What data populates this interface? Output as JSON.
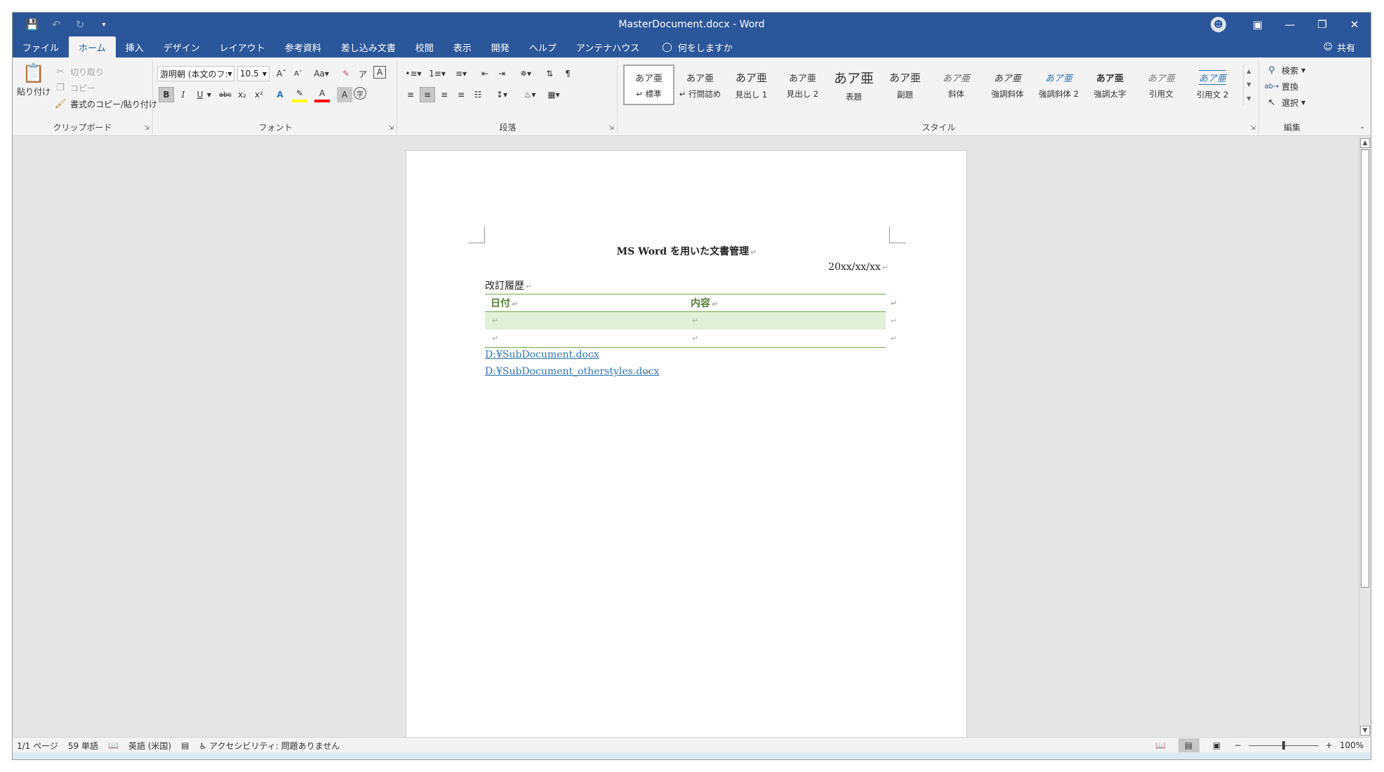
{
  "window": {
    "title": "MasterDocument.docx  -  Word"
  },
  "menu": {
    "tabs": [
      "ファイル",
      "ホーム",
      "挿入",
      "デザイン",
      "レイアウト",
      "参考資料",
      "差し込み文書",
      "校閲",
      "表示",
      "開発",
      "ヘルプ",
      "アンテナハウス"
    ],
    "active_tab": "ホーム",
    "tell_me": "何をしますか",
    "share": "共有"
  },
  "ribbon": {
    "clipboard": {
      "label": "クリップボード",
      "paste": "貼り付け",
      "cut": "切り取り",
      "copy": "コピー",
      "format_painter": "書式のコピー/貼り付け"
    },
    "font": {
      "label": "フォント",
      "font_name": "游明朝 (本文のフ:",
      "font_size": "10.5"
    },
    "paragraph": {
      "label": "段落"
    },
    "styles": {
      "label": "スタイル",
      "items": [
        {
          "sample": "あア亜",
          "name": "↵ 標準"
        },
        {
          "sample": "あア亜",
          "name": "↵ 行間詰め"
        },
        {
          "sample": "あア亜",
          "name": "見出し 1"
        },
        {
          "sample": "あア亜",
          "name": "見出し 2"
        },
        {
          "sample": "あア亜",
          "name": "表題"
        },
        {
          "sample": "あア亜",
          "name": "副題"
        },
        {
          "sample": "あア亜",
          "name": "斜体"
        },
        {
          "sample": "あア亜",
          "name": "強調斜体"
        },
        {
          "sample": "あア亜",
          "name": "強調斜体 2"
        },
        {
          "sample": "あア亜",
          "name": "強調太字"
        },
        {
          "sample": "あア亜",
          "name": "引用文"
        },
        {
          "sample": "あア亜",
          "name": "引用文 2"
        }
      ]
    },
    "editing": {
      "label": "編集",
      "find": "検索",
      "replace": "置換",
      "select": "選択"
    }
  },
  "document": {
    "title": "MS Word を用いた文書管理",
    "date": "20xx/xx/xx",
    "revision_label": "改訂履歴",
    "table": {
      "headers": [
        "日付",
        "内容"
      ]
    },
    "links": [
      "D:¥SubDocument.docx",
      "D:¥SubDocument_otherstyles.docx"
    ]
  },
  "status": {
    "page": "1/1 ページ",
    "words": "59 単語",
    "language": "英語 (米国)",
    "accessibility": "アクセシビリティ: 問題ありません",
    "zoom": "100%",
    "zoom_level": 0.5
  },
  "icons": {
    "save": "save-icon",
    "undo": "undo-icon",
    "redo": "redo-icon",
    "lightbulb": "lightbulb-icon"
  }
}
